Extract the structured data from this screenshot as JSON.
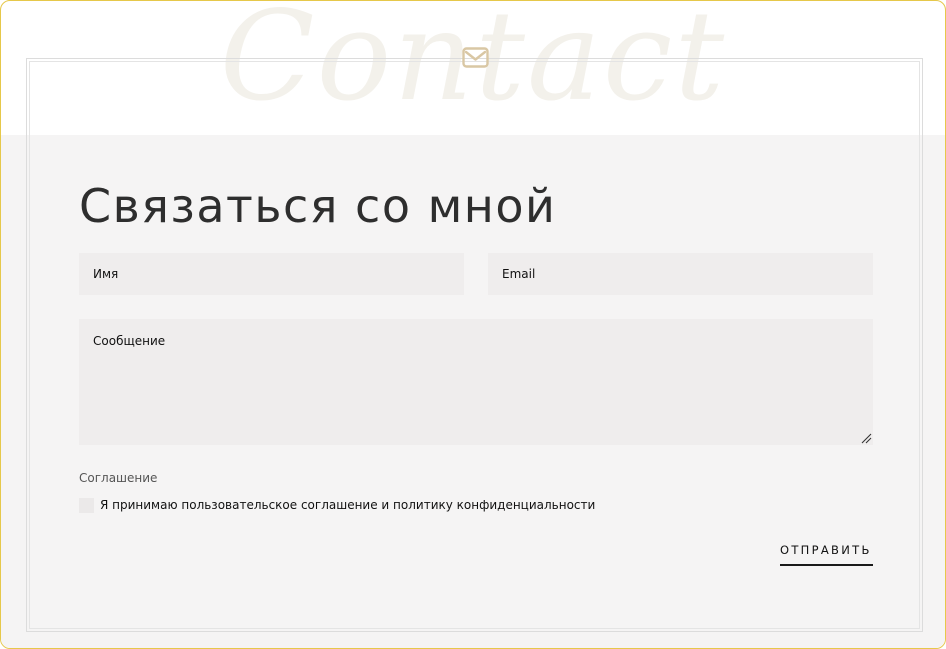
{
  "watermark": "Contact",
  "header": {
    "icon": "mail-icon",
    "title": "Связаться со мной"
  },
  "form": {
    "name_placeholder": "Имя",
    "email_placeholder": "Email",
    "message_placeholder": "Сообщение",
    "consent_heading": "Соглашение",
    "consent_label": "Я принимаю пользовательское соглашение и политику конфиденциальности",
    "submit_label": "ОТПРАВИТЬ"
  },
  "colors": {
    "frame_border": "#e6c84a",
    "icon_accent": "#d9c7a4",
    "field_bg": "#efeded"
  }
}
